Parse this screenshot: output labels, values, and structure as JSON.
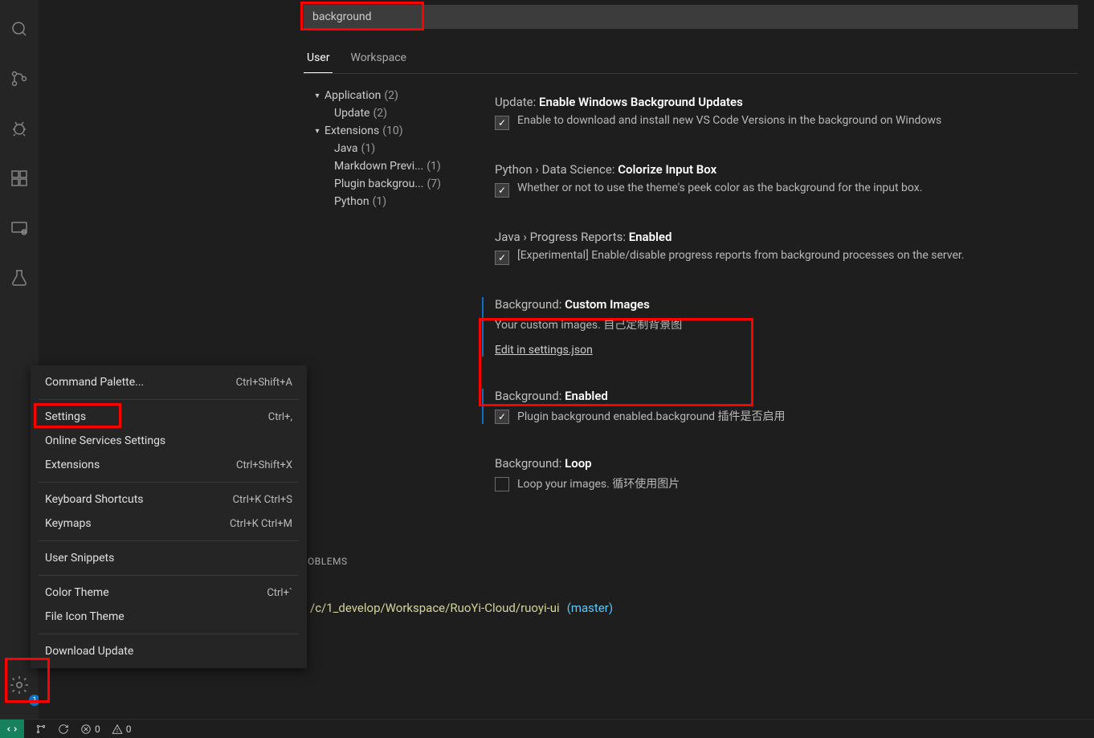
{
  "search": {
    "value": "background"
  },
  "tabs": {
    "user": "User",
    "workspace": "Workspace"
  },
  "tree": {
    "application": {
      "label": "Application",
      "count": "(2)"
    },
    "update": {
      "label": "Update",
      "count": "(2)"
    },
    "extensions": {
      "label": "Extensions",
      "count": "(10)"
    },
    "java": {
      "label": "Java",
      "count": "(1)"
    },
    "markdown": {
      "label": "Markdown Previ...",
      "count": "(1)"
    },
    "plugin": {
      "label": "Plugin backgrou...",
      "count": "(7)"
    },
    "python": {
      "label": "Python",
      "count": "(1)"
    }
  },
  "settings": {
    "s1": {
      "scope": "Update: ",
      "name": "Enable Windows Background Updates",
      "desc": "Enable to download and install new VS Code Versions in the background on Windows"
    },
    "s2": {
      "scope": "Python › Data Science: ",
      "name": "Colorize Input Box",
      "desc": "Whether or not to use the theme's peek color as the background for the input box."
    },
    "s3": {
      "scope": "Java › Progress Reports: ",
      "name": "Enabled",
      "desc": "[Experimental] Enable/disable progress reports from background processes on the server."
    },
    "s4": {
      "scope": "Background: ",
      "name": "Custom Images",
      "desc": "Your custom images. 自己定制背景图",
      "link": "Edit in settings.json"
    },
    "s5": {
      "scope": "Background: ",
      "name": "Enabled",
      "desc": "Plugin background enabled.background 插件是否启用"
    },
    "s6": {
      "scope": "Background: ",
      "name": "Loop",
      "desc": "Loop your images. 循环使用图片"
    }
  },
  "panel": {
    "problems": "OBLEMS"
  },
  "terminal": {
    "path": "/c/1_develop/Workspace/RuoYi-Cloud/ruoyi-ui",
    "branch": "(master)"
  },
  "menu": {
    "commandPalette": {
      "label": "Command Palette...",
      "shortcut": "Ctrl+Shift+A"
    },
    "settings": {
      "label": "Settings",
      "shortcut": "Ctrl+,"
    },
    "onlineServices": {
      "label": "Online Services Settings",
      "shortcut": ""
    },
    "extensions": {
      "label": "Extensions",
      "shortcut": "Ctrl+Shift+X"
    },
    "keyboardShortcuts": {
      "label": "Keyboard Shortcuts",
      "shortcut": "Ctrl+K Ctrl+S"
    },
    "keymaps": {
      "label": "Keymaps",
      "shortcut": "Ctrl+K Ctrl+M"
    },
    "userSnippets": {
      "label": "User Snippets",
      "shortcut": ""
    },
    "colorTheme": {
      "label": "Color Theme",
      "shortcut": "Ctrl+`"
    },
    "fileIconTheme": {
      "label": "File Icon Theme",
      "shortcut": ""
    },
    "downloadUpdate": {
      "label": "Download Update",
      "shortcut": ""
    }
  },
  "status": {
    "errors": "0",
    "warnings": "0",
    "gearBadge": "1"
  }
}
